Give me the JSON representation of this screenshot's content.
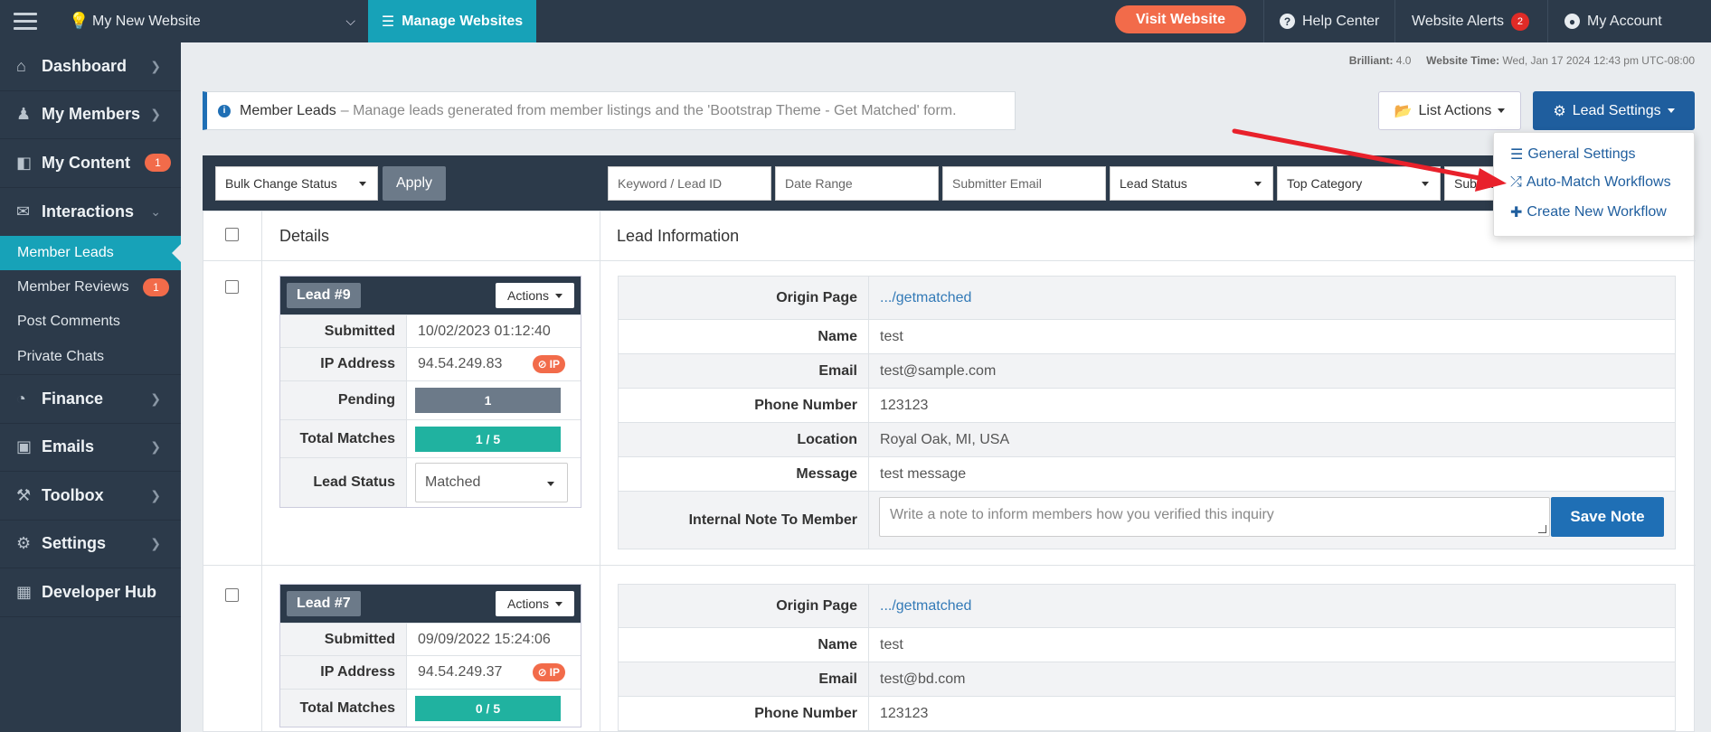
{
  "topbar": {
    "site_name": "My New Website",
    "manage_label": "Manage Websites",
    "visit_label": "Visit Website",
    "help_label": "Help Center",
    "alerts_label": "Website Alerts",
    "alerts_count": "2",
    "account_label": "My Account"
  },
  "sidebar": {
    "items": [
      {
        "label": "Dashboard",
        "icon": "home-icon"
      },
      {
        "label": "My Members",
        "icon": "users-icon"
      },
      {
        "label": "My Content",
        "icon": "folder-icon",
        "badge": "1"
      },
      {
        "label": "Interactions",
        "icon": "comments-icon"
      }
    ],
    "sub_items": [
      {
        "label": "Member Leads",
        "active": true
      },
      {
        "label": "Member Reviews",
        "badge": "1"
      },
      {
        "label": "Post Comments"
      },
      {
        "label": "Private Chats"
      }
    ],
    "items_bottom": [
      {
        "label": "Finance",
        "icon": "pie-chart-icon"
      },
      {
        "label": "Emails",
        "icon": "inbox-icon"
      },
      {
        "label": "Toolbox",
        "icon": "wrench-icon"
      },
      {
        "label": "Settings",
        "icon": "gear-icon"
      },
      {
        "label": "Developer Hub",
        "icon": "grid-icon"
      }
    ]
  },
  "meta": {
    "version_label": "Brilliant:",
    "version": "4.0",
    "time_label": "Website Time:",
    "time": "Wed, Jan 17 2024 12:43 pm UTC-08:00"
  },
  "info": {
    "title": "Member Leads",
    "description": "– Manage leads generated from member listings and the 'Bootstrap Theme - Get Matched' form."
  },
  "buttons": {
    "list_actions": "List Actions",
    "lead_settings": "Lead Settings"
  },
  "dropdown": {
    "items": [
      "General Settings",
      "Auto-Match Workflows",
      "Create New Workflow"
    ]
  },
  "filters": {
    "bulk_status": "Bulk Change Status",
    "apply": "Apply",
    "keyword_placeholder": "Keyword / Lead ID",
    "date_placeholder": "Date Range",
    "email_placeholder": "Submitter Email",
    "lead_status": "Lead Status",
    "top_category": "Top Category",
    "sub_category": "Subcat"
  },
  "table": {
    "col_details": "Details",
    "col_info": "Lead Information"
  },
  "leads": [
    {
      "tag": "Lead #9",
      "actions": "Actions",
      "submitted_label": "Submitted",
      "submitted": "10/02/2023 01:12:40",
      "ip_label": "IP Address",
      "ip": "94.54.249.83",
      "ip_badge": "IP",
      "pending_label": "Pending",
      "pending": "1",
      "matches_label": "Total Matches",
      "matches": "1 / 5",
      "status_label": "Lead Status",
      "status": "Matched",
      "info": {
        "origin_label": "Origin Page",
        "origin": ".../getmatched",
        "name_label": "Name",
        "name": "test",
        "email_label": "Email",
        "email": "test@sample.com",
        "phone_label": "Phone Number",
        "phone": "123123",
        "location_label": "Location",
        "location": "Royal Oak, MI, USA",
        "message_label": "Message",
        "message": "test message",
        "note_label": "Internal Note To Member",
        "note_placeholder": "Write a note to inform members how you verified this inquiry",
        "save_label": "Save Note"
      }
    },
    {
      "tag": "Lead #7",
      "actions": "Actions",
      "submitted_label": "Submitted",
      "submitted": "09/09/2022 15:24:06",
      "ip_label": "IP Address",
      "ip": "94.54.249.37",
      "ip_badge": "IP",
      "matches_label": "Total Matches",
      "matches": "0 / 5",
      "info": {
        "origin_label": "Origin Page",
        "origin": ".../getmatched",
        "name_label": "Name",
        "name": "test",
        "email_label": "Email",
        "email": "test@bd.com",
        "phone_label": "Phone Number",
        "phone": "123123"
      }
    }
  ],
  "colors": {
    "sidebar_bg": "#2c3a4a",
    "accent_teal": "#17a2b8",
    "accent_orange": "#f26b4a",
    "primary_blue": "#1f5e9e",
    "annotation_red": "#e8212b"
  }
}
